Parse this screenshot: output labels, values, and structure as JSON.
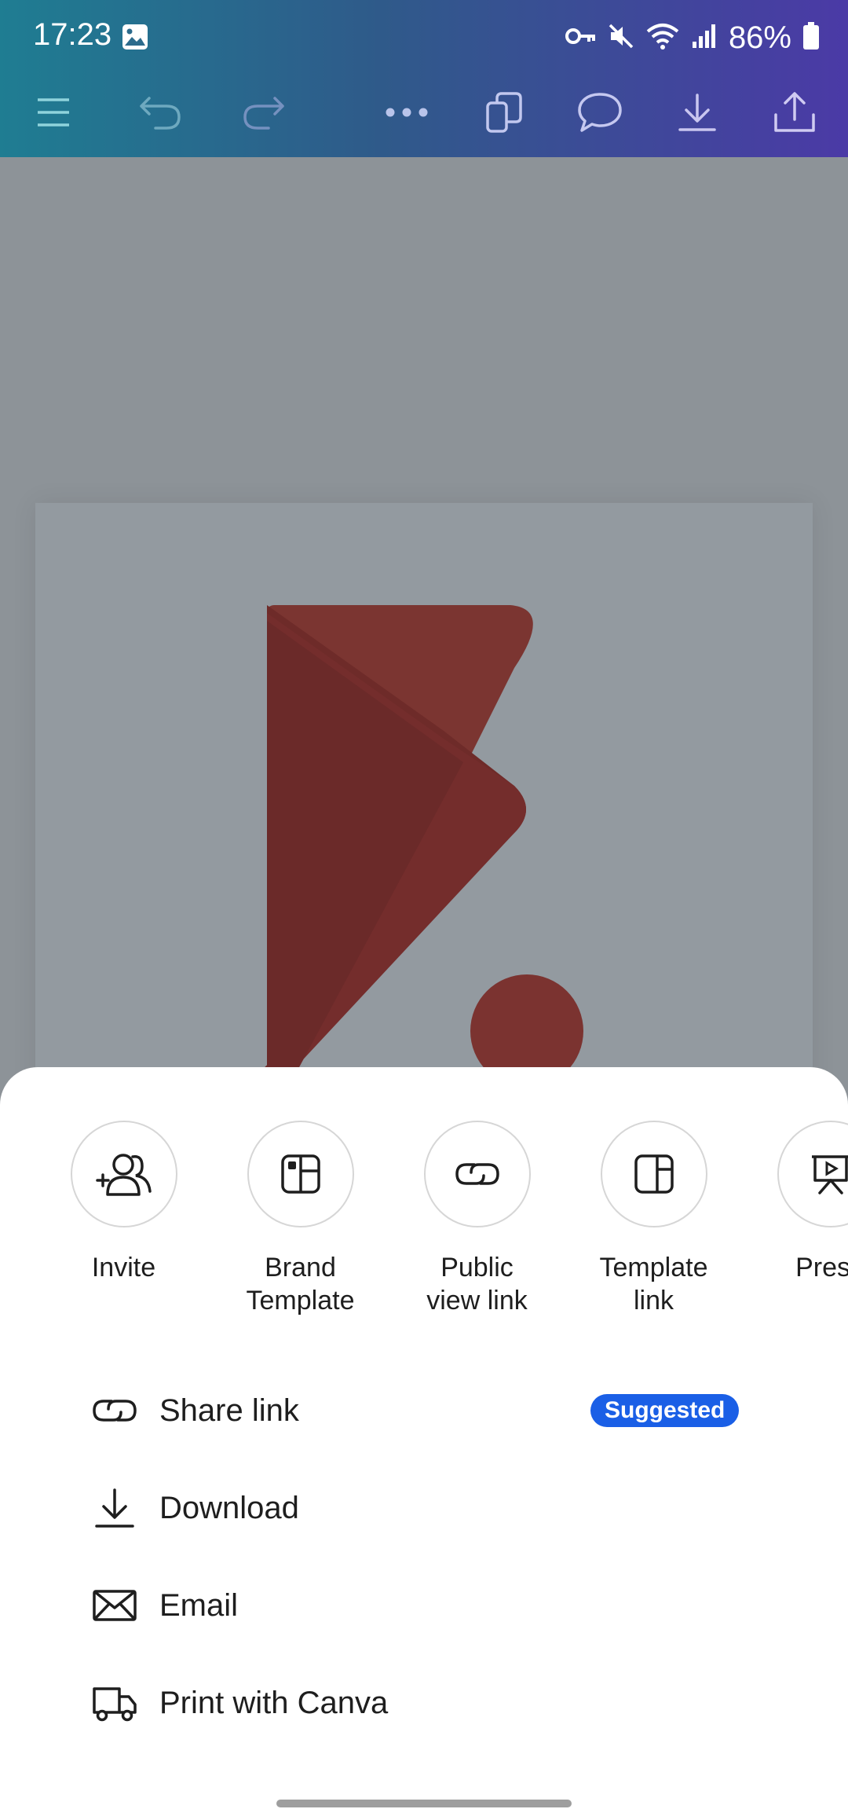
{
  "status_bar": {
    "time": "17:23",
    "battery": "86%",
    "icons": [
      "gallery-icon",
      "key-icon",
      "mute-icon",
      "wifi-icon",
      "signal-icon",
      "battery-icon"
    ]
  },
  "toolbar": {
    "icons": [
      "menu-icon",
      "undo-icon",
      "redo-icon",
      "more-icon",
      "copy-icon",
      "comment-icon",
      "download-icon",
      "share-icon"
    ]
  },
  "colors": {
    "header_start": "#1f7d92",
    "header_end": "#4b3aa6",
    "logo": "#7b2f2f",
    "badge": "#1a5fe6"
  },
  "share_options": [
    {
      "label": "Invite",
      "icon": "invite-icon"
    },
    {
      "label": "Brand\nTemplate",
      "icon": "brand-template-icon"
    },
    {
      "label": "Public\nview link",
      "icon": "link-icon"
    },
    {
      "label": "Template\nlink",
      "icon": "template-link-icon"
    },
    {
      "label": "Prese",
      "icon": "present-icon"
    }
  ],
  "menu": [
    {
      "label": "Share link",
      "badge": "Suggested",
      "icon": "link-icon"
    },
    {
      "label": "Download",
      "icon": "download-icon"
    },
    {
      "label": "Email",
      "icon": "email-icon"
    },
    {
      "label": "Print with Canva",
      "icon": "truck-icon"
    }
  ]
}
